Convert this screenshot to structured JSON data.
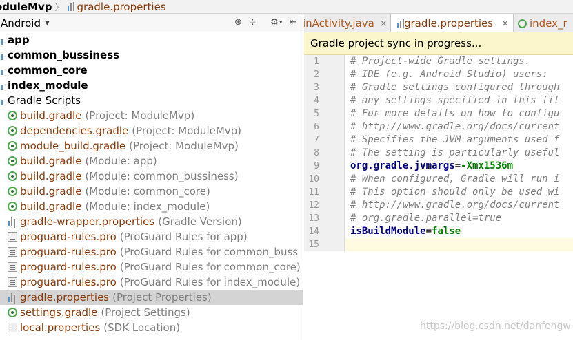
{
  "breadcrumb": {
    "project": "oduleMvp",
    "separator": "〉",
    "file": "gradle.properties"
  },
  "project_panel": {
    "view_mode": "Android",
    "tree": [
      {
        "kind": "module",
        "label": "app"
      },
      {
        "kind": "module",
        "label": "common_bussiness"
      },
      {
        "kind": "module",
        "label": "common_core"
      },
      {
        "kind": "module",
        "label": "index_module"
      },
      {
        "kind": "group",
        "label": "Gradle Scripts"
      },
      {
        "kind": "file",
        "icon": "gradle-icon",
        "name": "build.gradle",
        "hint": "(Project: ModuleMvp)"
      },
      {
        "kind": "file",
        "icon": "gradle-icon",
        "name": "dependencies.gradle",
        "hint": "(Project: ModuleMvp)"
      },
      {
        "kind": "file",
        "icon": "gradle-icon",
        "name": "module_build.gradle",
        "hint": "(Project: ModuleMvp)"
      },
      {
        "kind": "file",
        "icon": "gradle-icon",
        "name": "build.gradle",
        "hint": "(Module: app)"
      },
      {
        "kind": "file",
        "icon": "gradle-icon",
        "name": "build.gradle",
        "hint": "(Module: common_bussiness)"
      },
      {
        "kind": "file",
        "icon": "gradle-icon",
        "name": "build.gradle",
        "hint": "(Module: common_core)"
      },
      {
        "kind": "file",
        "icon": "gradle-icon",
        "name": "build.gradle",
        "hint": "(Module: index_module)"
      },
      {
        "kind": "file",
        "icon": "wrapper-properties-icon",
        "name": "gradle-wrapper.properties",
        "hint": "(Gradle Version)"
      },
      {
        "kind": "file",
        "icon": "proguard-file-icon",
        "name": "proguard-rules.pro",
        "hint": "(ProGuard Rules for app)"
      },
      {
        "kind": "file",
        "icon": "proguard-file-icon",
        "name": "proguard-rules.pro",
        "hint": "(ProGuard Rules for common_buss"
      },
      {
        "kind": "file",
        "icon": "proguard-file-icon",
        "name": "proguard-rules.pro",
        "hint": "(ProGuard Rules for common_core)"
      },
      {
        "kind": "file",
        "icon": "proguard-file-icon",
        "name": "proguard-rules.pro",
        "hint": "(ProGuard Rules for index_module)"
      },
      {
        "kind": "file",
        "icon": "wrapper-properties-icon",
        "name": "gradle.properties",
        "hint": "(Project Properties)",
        "selected": true
      },
      {
        "kind": "file",
        "icon": "gradle-icon",
        "name": "settings.gradle",
        "hint": "(Project Settings)"
      },
      {
        "kind": "file",
        "icon": "proguard-file-icon",
        "name": "local.properties",
        "hint": "(SDK Location)"
      }
    ]
  },
  "editor": {
    "tabs": [
      {
        "label": "inActivity.java",
        "active": false
      },
      {
        "label": "gradle.properties",
        "active": true
      },
      {
        "label": "index_r",
        "active": false
      }
    ],
    "close_glyph": "×",
    "sync_banner": "Gradle project sync in progress...",
    "lines": [
      {
        "num": "1",
        "type": "comment",
        "text": "# Project-wide Gradle settings."
      },
      {
        "num": "2",
        "type": "comment",
        "text": "# IDE (e.g. Android Studio) users:"
      },
      {
        "num": "3",
        "type": "comment",
        "text": "# Gradle settings configured through"
      },
      {
        "num": "4",
        "type": "comment",
        "text": "# any settings specified in this fil"
      },
      {
        "num": "5",
        "type": "comment",
        "text": "# For more details on how to configu"
      },
      {
        "num": "6",
        "type": "comment",
        "text": "# http://www.gradle.org/docs/current"
      },
      {
        "num": "7",
        "type": "comment",
        "text": "# Specifies the JVM arguments used f"
      },
      {
        "num": "8",
        "type": "comment",
        "text": "# The setting is particularly useful"
      },
      {
        "num": "9",
        "type": "property",
        "key": "org.gradle.jvmargs",
        "op": "=",
        "value": "-Xmx1536m"
      },
      {
        "num": "10",
        "type": "comment",
        "text": "# When configured, Gradle will run i"
      },
      {
        "num": "11",
        "type": "comment",
        "text": "# This option should only be used wi"
      },
      {
        "num": "12",
        "type": "comment",
        "text": "# http://www.gradle.org/docs/current"
      },
      {
        "num": "13",
        "type": "comment",
        "text": "# org.gradle.parallel=true"
      },
      {
        "num": "14",
        "type": "property",
        "key": "isBuildModule",
        "op": "=",
        "value": "false"
      },
      {
        "num": "15",
        "type": "empty",
        "text": "",
        "current": true
      }
    ]
  },
  "watermark": "https://blog.csdn.net/danfengw"
}
